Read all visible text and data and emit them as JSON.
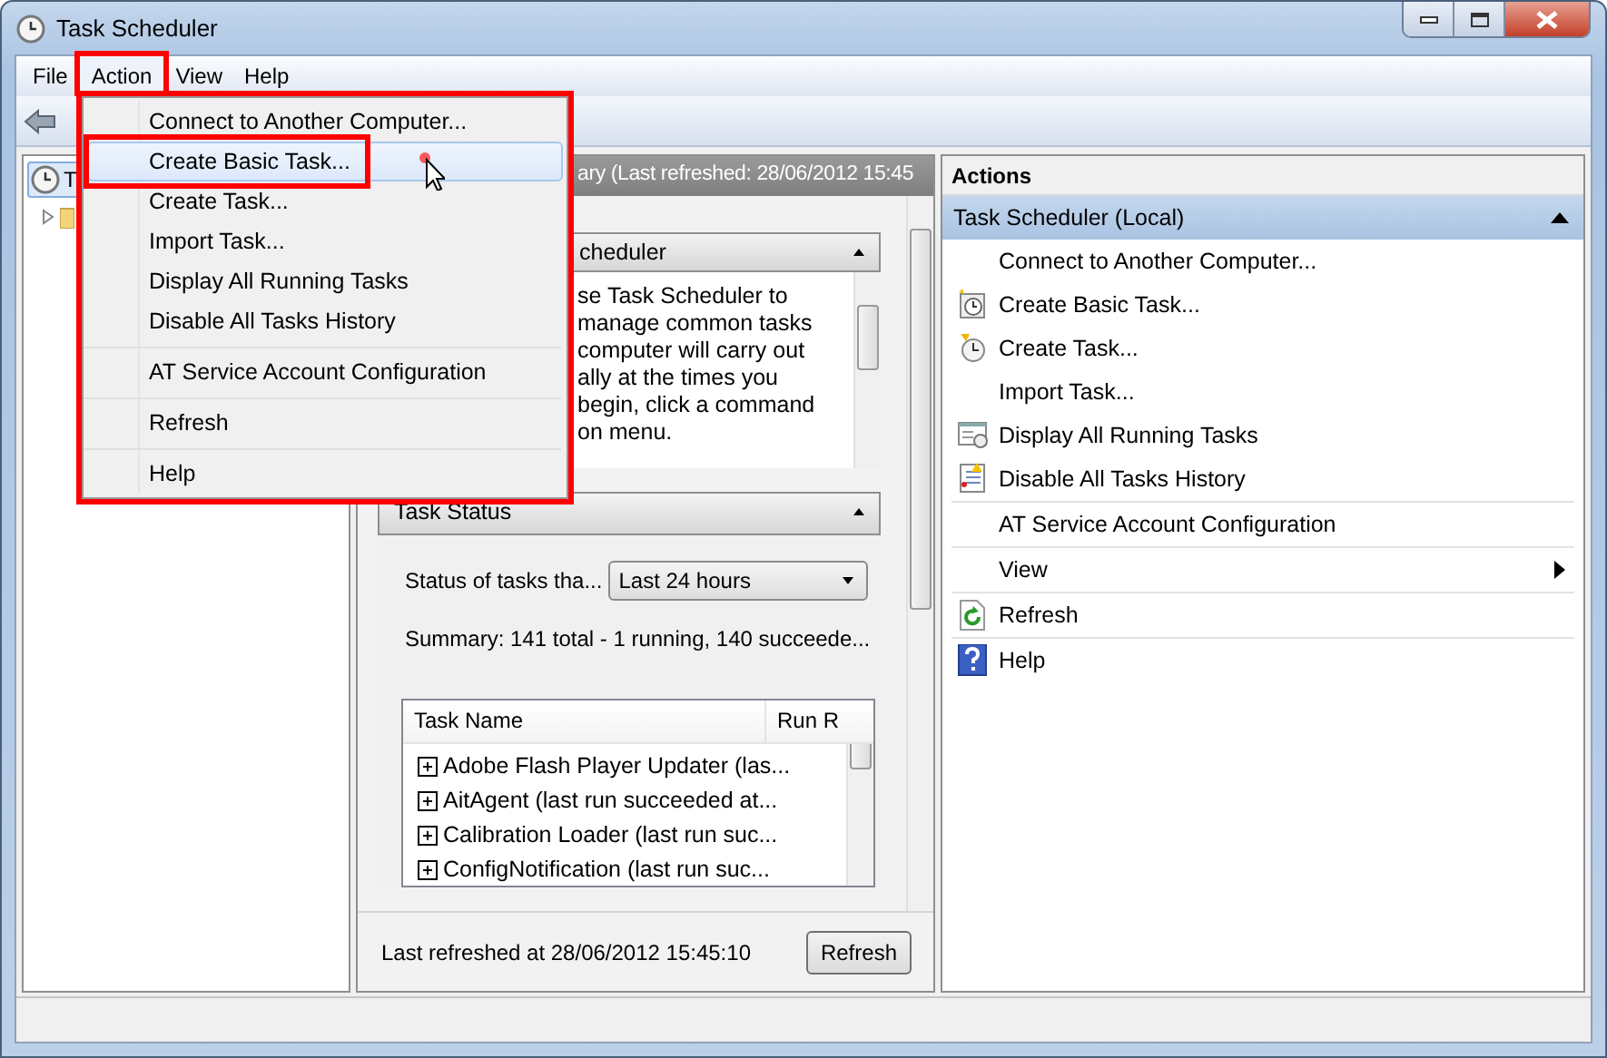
{
  "window": {
    "title": "Task Scheduler"
  },
  "menu_bar": [
    {
      "label": "File",
      "open": false,
      "outlined": false
    },
    {
      "label": "Action",
      "open": true,
      "outlined": true
    },
    {
      "label": "View",
      "open": false,
      "outlined": false
    },
    {
      "label": "Help",
      "open": false,
      "outlined": false
    }
  ],
  "action_menu": {
    "outlined": true,
    "items": [
      {
        "label": "Connect to Another Computer...",
        "separator_before": false,
        "highlighted": false,
        "outlined": false
      },
      {
        "label": "Create Basic Task...",
        "separator_before": false,
        "highlighted": true,
        "outlined": true
      },
      {
        "label": "Create Task...",
        "separator_before": false,
        "highlighted": false,
        "outlined": false
      },
      {
        "label": "Import Task...",
        "separator_before": false,
        "highlighted": false,
        "outlined": false
      },
      {
        "label": "Display All Running Tasks",
        "separator_before": false,
        "highlighted": false,
        "outlined": false
      },
      {
        "label": "Disable All Tasks History",
        "separator_before": false,
        "highlighted": false,
        "outlined": false
      },
      {
        "label": "AT Service Account Configuration",
        "separator_before": true,
        "highlighted": false,
        "outlined": false
      },
      {
        "label": "Refresh",
        "separator_before": true,
        "highlighted": false,
        "outlined": false
      },
      {
        "label": "Help",
        "separator_before": true,
        "highlighted": false,
        "outlined": false
      }
    ]
  },
  "tree": {
    "label": "T",
    "selected": true,
    "children": [
      {
        "expanded": false
      }
    ]
  },
  "summary_panel": {
    "title": "ary (Last refreshed: 28/06/2012 15:45",
    "overview": {
      "title": "cheduler",
      "expanded": true,
      "lines": [
        "se Task Scheduler to",
        "manage common tasks",
        "computer will carry out",
        "ally at the times you",
        "begin, click a command",
        "on menu."
      ]
    },
    "task_status": {
      "title": "Task Status",
      "expanded": true,
      "filter_label": "Status of tasks tha...",
      "filter_value": "Last 24 hours",
      "summary": "Summary: 141 total - 1 running, 140 succeede...",
      "table": {
        "columns": [
          "Task Name",
          "Run R"
        ],
        "rows": [
          {
            "name": "Adobe Flash Player Updater (las...",
            "expanded": false
          },
          {
            "name": "AitAgent (last run succeeded at...",
            "expanded": false
          },
          {
            "name": "Calibration Loader (last run suc...",
            "expanded": false
          },
          {
            "name": "ConfigNotification (last run suc...",
            "expanded": false
          }
        ]
      }
    },
    "footer": "Last refreshed at 28/06/2012 15:45:10",
    "refresh_button": "Refresh"
  },
  "actions": {
    "title": "Actions",
    "group": {
      "title": "Task Scheduler (Local)",
      "expanded": true,
      "items": [
        {
          "label": "Connect to Another Computer...",
          "kind": "plain",
          "separator_before": false
        },
        {
          "label": "Create Basic Task...",
          "kind": "new-clock",
          "separator_before": false
        },
        {
          "label": "Create Task...",
          "kind": "clock",
          "separator_before": false
        },
        {
          "label": "Import Task...",
          "kind": "plain",
          "separator_before": false
        },
        {
          "label": "Display All Running Tasks",
          "kind": "window-list",
          "separator_before": false
        },
        {
          "label": "Disable All Tasks History",
          "kind": "log",
          "separator_before": false
        },
        {
          "label": "AT Service Account Configuration",
          "kind": "plain",
          "separator_before": true
        },
        {
          "label": "View",
          "kind": "submenu",
          "separator_before": true
        },
        {
          "label": "Refresh",
          "kind": "refresh",
          "separator_before": true
        },
        {
          "label": "Help",
          "kind": "help",
          "separator_before": true
        }
      ]
    }
  }
}
